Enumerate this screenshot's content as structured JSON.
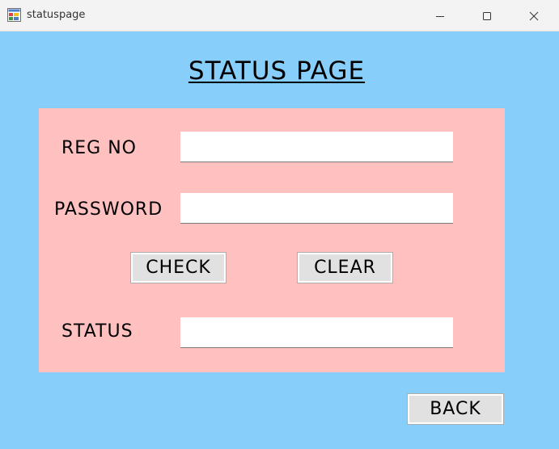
{
  "window": {
    "title": "statuspage",
    "icons": {
      "app": "form-app-icon",
      "minimize": "minimize-icon",
      "maximize": "maximize-icon",
      "close": "close-icon"
    }
  },
  "page": {
    "heading": "STATUS  PAGE"
  },
  "form": {
    "reg_no_label": "REG NO",
    "reg_no_value": "",
    "password_label": "PASSWORD",
    "password_value": "",
    "status_label": "STATUS",
    "status_value": ""
  },
  "buttons": {
    "check": "CHECK",
    "clear": "CLEAR",
    "back": "BACK"
  },
  "colors": {
    "background": "#87cefa",
    "panel": "#ffc0c0",
    "button": "#e1e1e1",
    "titlebar": "#f3f3f3"
  }
}
